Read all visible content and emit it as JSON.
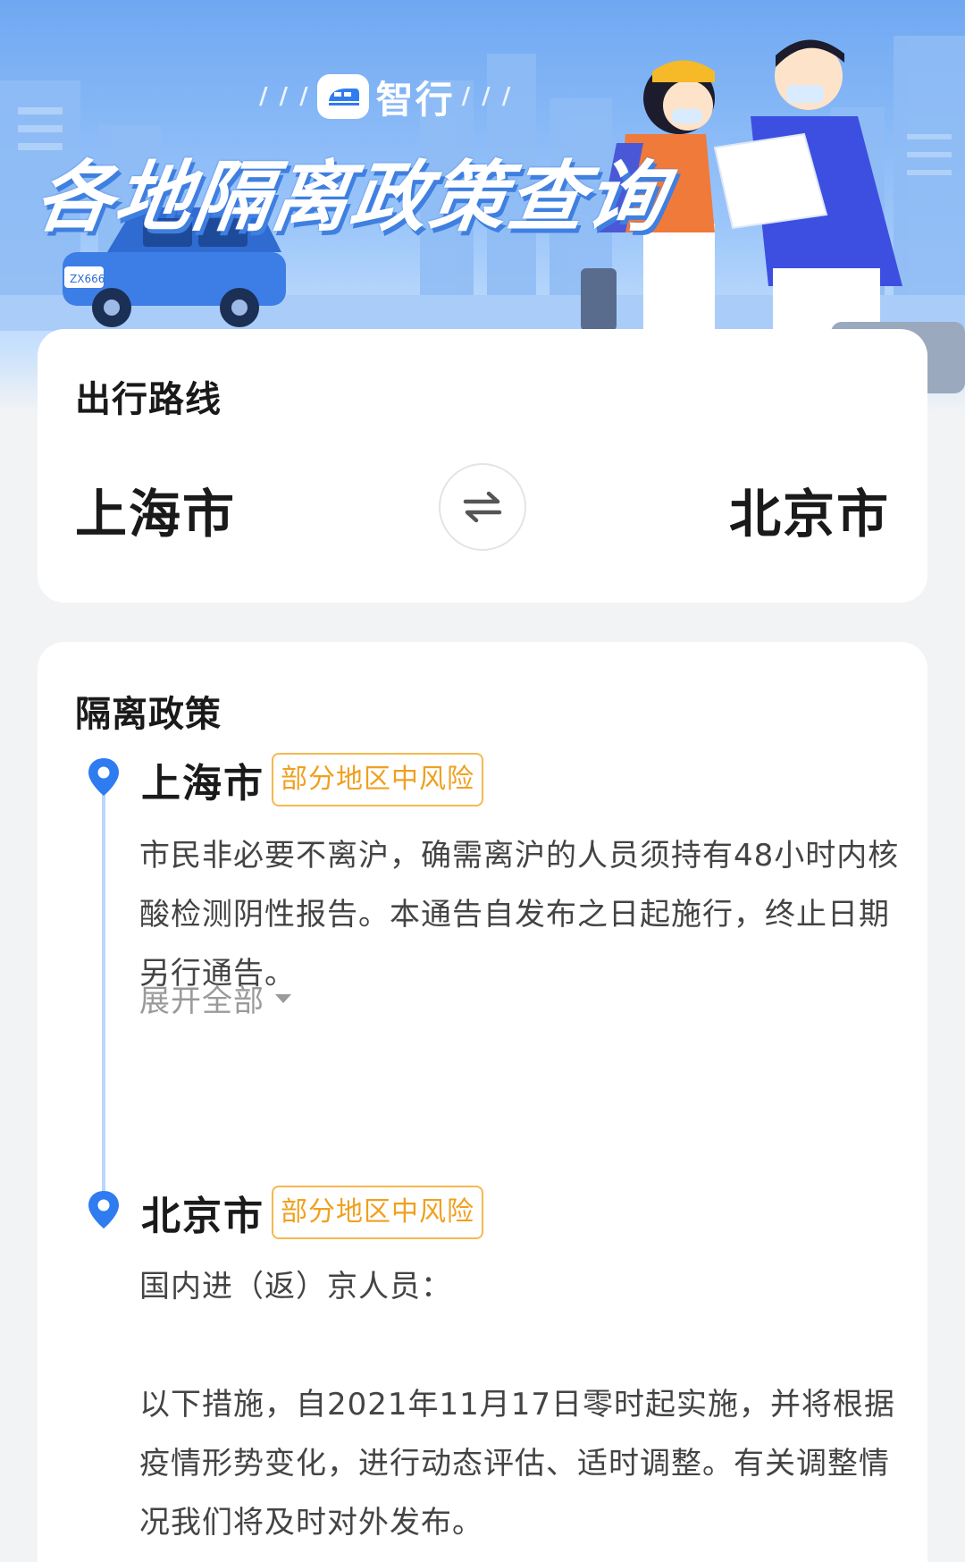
{
  "banner": {
    "brand_name": "智行",
    "title": "各地隔离政策查询",
    "car_plate": "ZX666"
  },
  "route": {
    "heading": "出行路线",
    "from_city": "上海市",
    "to_city": "北京市",
    "swap_icon": "swap-arrows-icon"
  },
  "policy": {
    "heading": "隔离政策",
    "entries": [
      {
        "city": "上海市",
        "risk": "部分地区中风险",
        "paragraphs": [
          "市民非必要不离沪，确需离沪的人员须持有48小时内核酸检测阴性报告。本通告自发布之日起施行，终止日期另行通告。"
        ],
        "expand_label": "展开全部"
      },
      {
        "city": "北京市",
        "risk": "部分地区中风险",
        "paragraphs": [
          "国内进（返）京人员：",
          "以下措施，自2021年11月17日零时起实施，并将根据疫情形势变化，进行动态评估、适时调整。有关调整情况我们将及时对外发布。"
        ]
      }
    ]
  },
  "colors": {
    "accent_blue": "#3b82f6",
    "risk_orange": "#f0a020",
    "banner_blue": "#6fa8f2"
  }
}
